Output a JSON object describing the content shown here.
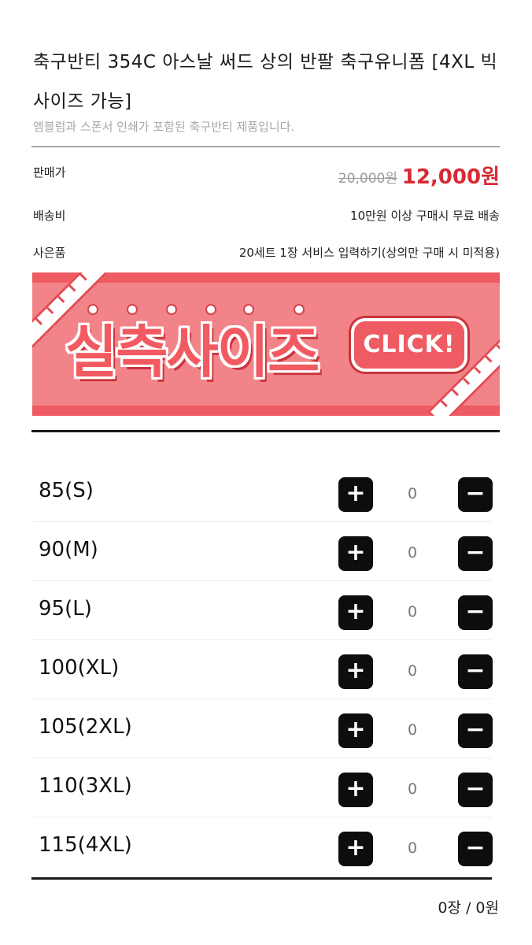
{
  "product": {
    "title": "축구반티 354C 아스날 써드 상의 반팔 축구유니폼 [4XL 빅사이즈 가능]",
    "subtitle": "엠블럼과 스폰서 인쇄가 포함된 축구반티 제품입니다."
  },
  "pricing": {
    "label": "판매가",
    "original_price": "20,000원",
    "sale_price": "12,000원"
  },
  "shipping": {
    "label": "배송비",
    "value": "10만원 이상 구매시 무료 배송"
  },
  "gift": {
    "label": "사은품",
    "value": "20세트 1장 서비스 입력하기(상의만 구매 시 미적용)"
  },
  "banner": {
    "text": "실측사이즈",
    "button_label": "CLICK!"
  },
  "sizes": [
    {
      "label": "85(S)",
      "qty": "0"
    },
    {
      "label": "90(M)",
      "qty": "0"
    },
    {
      "label": "95(L)",
      "qty": "0"
    },
    {
      "label": "100(XL)",
      "qty": "0"
    },
    {
      "label": "105(2XL)",
      "qty": "0"
    },
    {
      "label": "110(3XL)",
      "qty": "0"
    },
    {
      "label": "115(4XL)",
      "qty": "0"
    }
  ],
  "controls": {
    "plus": "+",
    "minus": "−"
  },
  "summary": {
    "total": "0장 / 0원"
  },
  "colors": {
    "sale_price": "#d72b33",
    "banner_bg": "#f28489",
    "banner_accent": "#ef5b62",
    "button_bg": "#0d0d0d"
  }
}
